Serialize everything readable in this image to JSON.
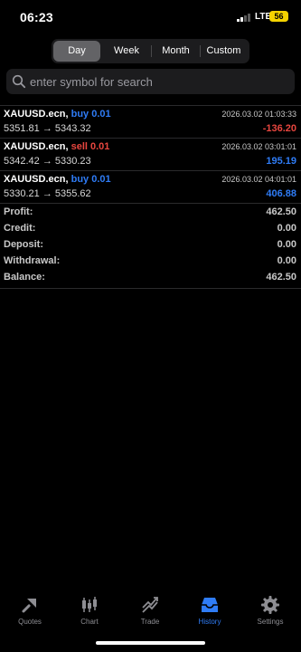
{
  "status_bar": {
    "time": "06:23",
    "network": "LTE",
    "battery": "56"
  },
  "period_tabs": [
    {
      "label": "Day",
      "active": true
    },
    {
      "label": "Week",
      "active": false
    },
    {
      "label": "Month",
      "active": false
    },
    {
      "label": "Custom",
      "active": false
    }
  ],
  "search": {
    "placeholder": "enter symbol for search"
  },
  "deals": [
    {
      "symbol": "XAUUSD.ecn,",
      "side": "buy 0.01",
      "side_type": "buy",
      "open_price": "5351.81",
      "arrow": "→",
      "close_price": "5343.32",
      "time": "2026.03.02 01:03:33",
      "profit": "-136.20"
    },
    {
      "symbol": "XAUUSD.ecn,",
      "side": "sell 0.01",
      "side_type": "sell",
      "open_price": "5342.42",
      "arrow": "→",
      "close_price": "5330.23",
      "time": "2026.03.02 03:01:01",
      "profit": "195.19"
    },
    {
      "symbol": "XAUUSD.ecn,",
      "side": "buy 0.01",
      "side_type": "buy",
      "open_price": "5330.21",
      "arrow": "→",
      "close_price": "5355.62",
      "time": "2026.03.02 04:01:01",
      "profit": "406.88"
    }
  ],
  "summary": [
    {
      "label": "Profit:",
      "value": "462.50"
    },
    {
      "label": "Credit:",
      "value": "0.00"
    },
    {
      "label": "Deposit:",
      "value": "0.00"
    },
    {
      "label": "Withdrawal:",
      "value": "0.00"
    },
    {
      "label": "Balance:",
      "value": "462.50"
    }
  ],
  "tabbar": [
    {
      "label": "Quotes",
      "icon": "quotes-icon",
      "active": false
    },
    {
      "label": "Chart",
      "icon": "candlestick-chart-icon",
      "active": false
    },
    {
      "label": "Trade",
      "icon": "trade-icon",
      "active": false
    },
    {
      "label": "History",
      "icon": "history-inbox-icon",
      "active": true
    },
    {
      "label": "Settings",
      "icon": "gear-icon",
      "active": false
    }
  ],
  "colors": {
    "accent": "#2f7cf6",
    "negative": "#e8463f",
    "background": "#000000",
    "inactive_tab": "#8e8e93",
    "battery": "#f5d300"
  }
}
